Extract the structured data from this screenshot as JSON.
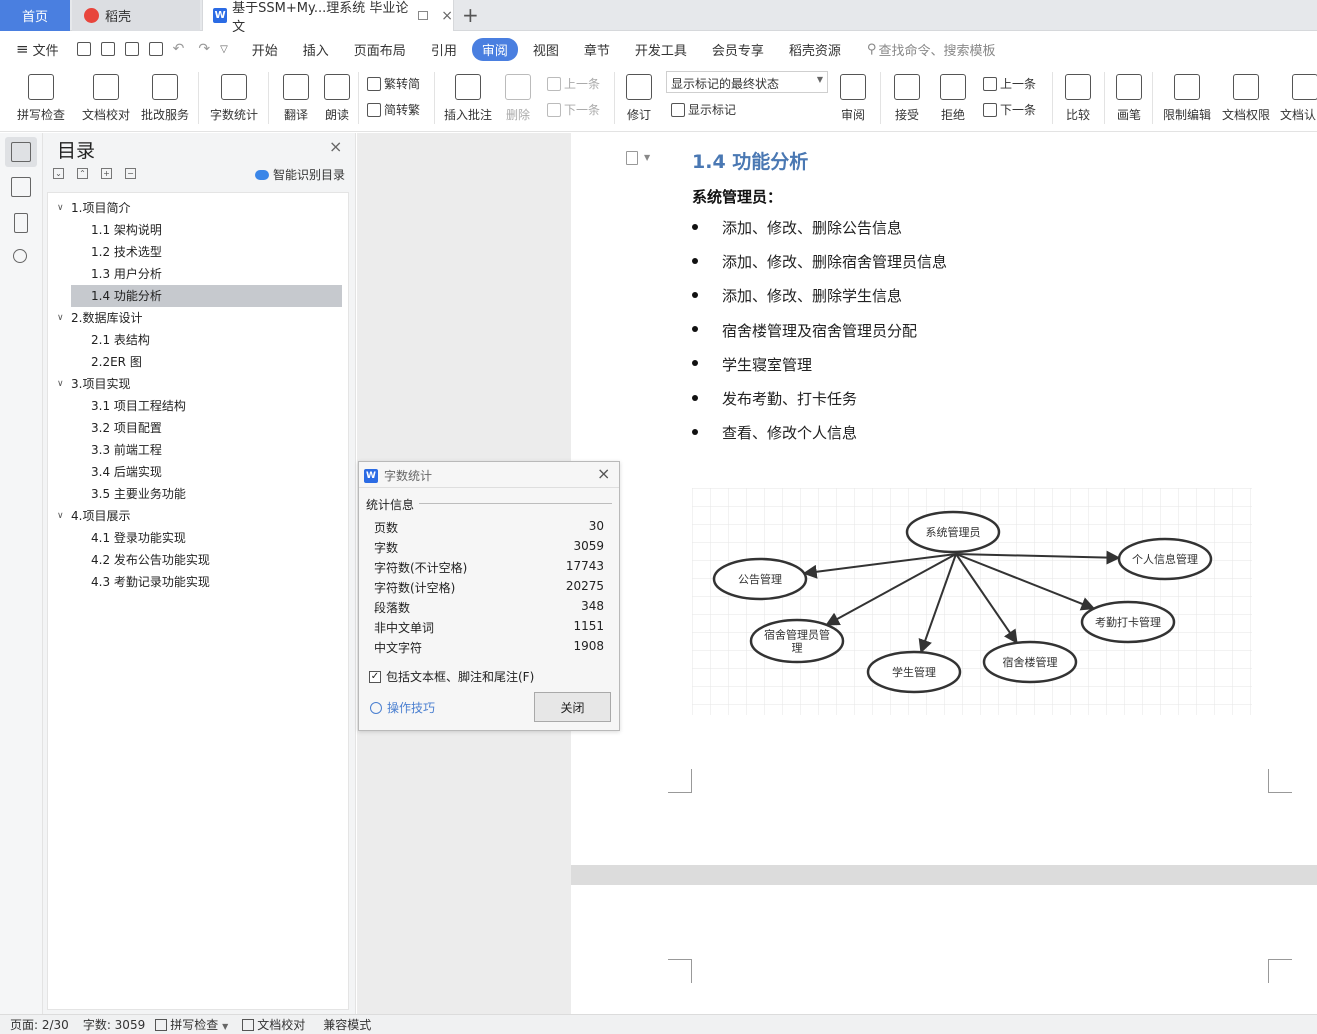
{
  "tabs": {
    "home": "首页",
    "daoke": "稻壳",
    "doc": "基于SSM+My...理系统 毕业论文",
    "doc_close": "×",
    "add": "+"
  },
  "menu": {
    "file": "文件",
    "items": [
      "开始",
      "插入",
      "页面布局",
      "引用",
      "审阅",
      "视图",
      "章节",
      "开发工具",
      "会员专享",
      "稻壳资源"
    ],
    "active": "审阅",
    "search": "查找命令、搜索模板"
  },
  "ribbon": {
    "spell_check": "拼写检查",
    "doc_proof": "文档校对",
    "revise_service": "批改服务",
    "word_count": "字数统计",
    "translate": "翻译",
    "read_aloud": "朗读",
    "trad_to_simp": "繁转简",
    "simp_to_trad": "简转繁",
    "insert_comment": "插入批注",
    "delete": "删除",
    "prev": "上一条",
    "next": "下一条",
    "track": "修订",
    "display_mode": "显示标记的最终状态",
    "show_markup": "显示标记",
    "review": "审阅",
    "accept": "接受",
    "reject": "拒绝",
    "prev2": "上一条",
    "next2": "下一条",
    "compare": "比较",
    "pen": "画笔",
    "restrict_edit": "限制编辑",
    "doc_permission": "文档权限",
    "doc_cert": "文档认"
  },
  "toc": {
    "title": "目录",
    "smart": "智能识别目录",
    "items": [
      {
        "label": "1.项目简介",
        "level": 1
      },
      {
        "label": "1.1 架构说明",
        "level": 2
      },
      {
        "label": "1.2 技术选型",
        "level": 2
      },
      {
        "label": "1.3 用户分析",
        "level": 2
      },
      {
        "label": "1.4 功能分析",
        "level": 2,
        "selected": true
      },
      {
        "label": "2.数据库设计",
        "level": 1
      },
      {
        "label": "2.1 表结构",
        "level": 2
      },
      {
        "label": "2.2ER 图",
        "level": 2
      },
      {
        "label": "3.项目实现",
        "level": 1
      },
      {
        "label": "3.1 项目工程结构",
        "level": 2
      },
      {
        "label": "3.2 项目配置",
        "level": 2
      },
      {
        "label": "3.3 前端工程",
        "level": 2
      },
      {
        "label": "3.4 后端实现",
        "level": 2
      },
      {
        "label": "3.5 主要业务功能",
        "level": 2
      },
      {
        "label": "4.项目展示",
        "level": 1
      },
      {
        "label": "4.1  登录功能实现",
        "level": 2
      },
      {
        "label": "4.2  发布公告功能实现",
        "level": 2
      },
      {
        "label": "4.3  考勤记录功能实现",
        "level": 2
      }
    ]
  },
  "document": {
    "heading": "1.4 功能分析",
    "subheading": "系统管理员：",
    "bullets": [
      "添加、修改、删除公告信息",
      "添加、修改、删除宿舍管理员信息",
      "添加、修改、删除学生信息",
      "宿舍楼管理及宿舍管理员分配",
      "学生寝室管理",
      "发布考勤、打卡任务",
      "查看、修改个人信息"
    ],
    "diagram": {
      "center": "系统管理员",
      "nodes": [
        "个人信息管理",
        "公告管理",
        "考勤打卡管理",
        "宿舍管理员管理",
        "学生管理",
        "宿舍楼管理"
      ]
    }
  },
  "dialog": {
    "title": "字数统计",
    "section": "统计信息",
    "rows": [
      {
        "label": "页数",
        "value": "30"
      },
      {
        "label": "字数",
        "value": "3059"
      },
      {
        "label": "字符数(不计空格)",
        "value": "17743"
      },
      {
        "label": "字符数(计空格)",
        "value": "20275"
      },
      {
        "label": "段落数",
        "value": "348"
      },
      {
        "label": "非中文单词",
        "value": "1151"
      },
      {
        "label": "中文字符",
        "value": "1908"
      }
    ],
    "include_check": "包括文本框、脚注和尾注(F)",
    "tips": "操作技巧",
    "close": "关闭"
  },
  "status": {
    "page": "页面: 2/30",
    "words": "字数: 3059",
    "spell": "拼写检查",
    "proof": "文档校对",
    "compat": "兼容模式"
  },
  "colors": {
    "accent": "#4a7fe0",
    "heading": "#4a78b3"
  }
}
